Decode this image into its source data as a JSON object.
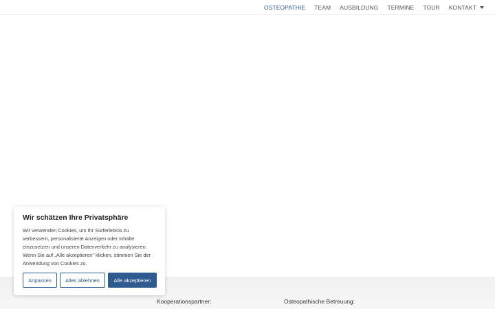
{
  "nav": {
    "items": [
      {
        "label": "OSTEOPATHIE",
        "active": true
      },
      {
        "label": "TEAM",
        "active": false
      },
      {
        "label": "AUSBILDUNG",
        "active": false
      },
      {
        "label": "TERMINE",
        "active": false
      },
      {
        "label": "TOUR",
        "active": false
      },
      {
        "label": "KONTAKT",
        "active": false,
        "has_dropdown": true
      }
    ]
  },
  "cookie_banner": {
    "title": "Wir schätzen Ihre Privatsphäre",
    "text": "Wir verwenden Cookies, um Ihr Surferlebnis zu verbessern, personalisierte Anzeigen oder Inhalte einzusetzen und unseren Datenverkehr zu analysieren. Wenn Sie auf „Alle akzeptieren\" klicken, stimmen Sie der Anwendung von Cookies zu.",
    "customize_label": "Anpassen",
    "reject_label": "Alles ablehnen",
    "accept_label": "Alle akzeptieren"
  },
  "footer": {
    "partners_heading": "Kooperationspartner:",
    "care_heading": "Osteopathische Betreuung:"
  },
  "colors": {
    "accent": "#2e5a8f",
    "nav_text": "#555555",
    "footer_bg": "#f3f3f3"
  },
  "icons": {
    "dropdown": "chevron-down-icon"
  }
}
